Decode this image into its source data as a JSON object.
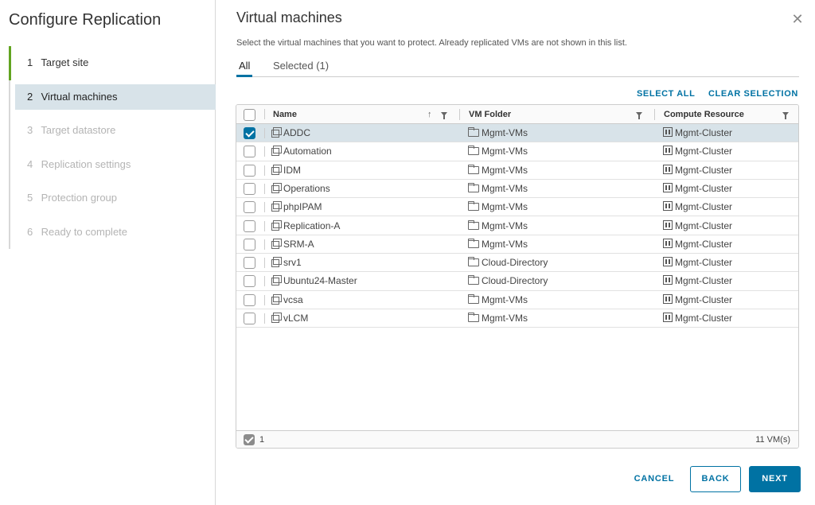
{
  "sidebar": {
    "title": "Configure Replication",
    "steps": [
      {
        "num": "1",
        "label": "Target site"
      },
      {
        "num": "2",
        "label": "Virtual machines"
      },
      {
        "num": "3",
        "label": "Target datastore"
      },
      {
        "num": "4",
        "label": "Replication settings"
      },
      {
        "num": "5",
        "label": "Protection group"
      },
      {
        "num": "6",
        "label": "Ready to complete"
      }
    ]
  },
  "main": {
    "title": "Virtual machines",
    "description": "Select the virtual machines that you want to protect. Already replicated VMs are not shown in this list.",
    "tabs": {
      "all": "All",
      "selected": "Selected (1)"
    },
    "select_all": "SELECT ALL",
    "clear_selection": "CLEAR SELECTION"
  },
  "grid": {
    "columns": {
      "name": "Name",
      "folder": "VM Folder",
      "compute": "Compute Resource"
    },
    "rows": [
      {
        "name": "ADDC",
        "folder": "Mgmt-VMs",
        "compute": "Mgmt-Cluster",
        "checked": true
      },
      {
        "name": "Automation",
        "folder": "Mgmt-VMs",
        "compute": "Mgmt-Cluster",
        "checked": false
      },
      {
        "name": "IDM",
        "folder": "Mgmt-VMs",
        "compute": "Mgmt-Cluster",
        "checked": false
      },
      {
        "name": "Operations",
        "folder": "Mgmt-VMs",
        "compute": "Mgmt-Cluster",
        "checked": false
      },
      {
        "name": "phpIPAM",
        "folder": "Mgmt-VMs",
        "compute": "Mgmt-Cluster",
        "checked": false
      },
      {
        "name": "Replication-A",
        "folder": "Mgmt-VMs",
        "compute": "Mgmt-Cluster",
        "checked": false
      },
      {
        "name": "SRM-A",
        "folder": "Mgmt-VMs",
        "compute": "Mgmt-Cluster",
        "checked": false
      },
      {
        "name": "srv1",
        "folder": "Cloud-Directory",
        "compute": "Mgmt-Cluster",
        "checked": false
      },
      {
        "name": "Ubuntu24-Master",
        "folder": "Cloud-Directory",
        "compute": "Mgmt-Cluster",
        "checked": false
      },
      {
        "name": "vcsa",
        "folder": "Mgmt-VMs",
        "compute": "Mgmt-Cluster",
        "checked": false
      },
      {
        "name": "vLCM",
        "folder": "Mgmt-VMs",
        "compute": "Mgmt-Cluster",
        "checked": false
      }
    ],
    "footer": {
      "selected_count": "1",
      "total": "11 VM(s)"
    }
  },
  "buttons": {
    "cancel": "CANCEL",
    "back": "BACK",
    "next": "NEXT"
  },
  "colors": {
    "accent": "#0072a3",
    "done_step": "#62a420",
    "selected_row": "#d8e3e9"
  }
}
